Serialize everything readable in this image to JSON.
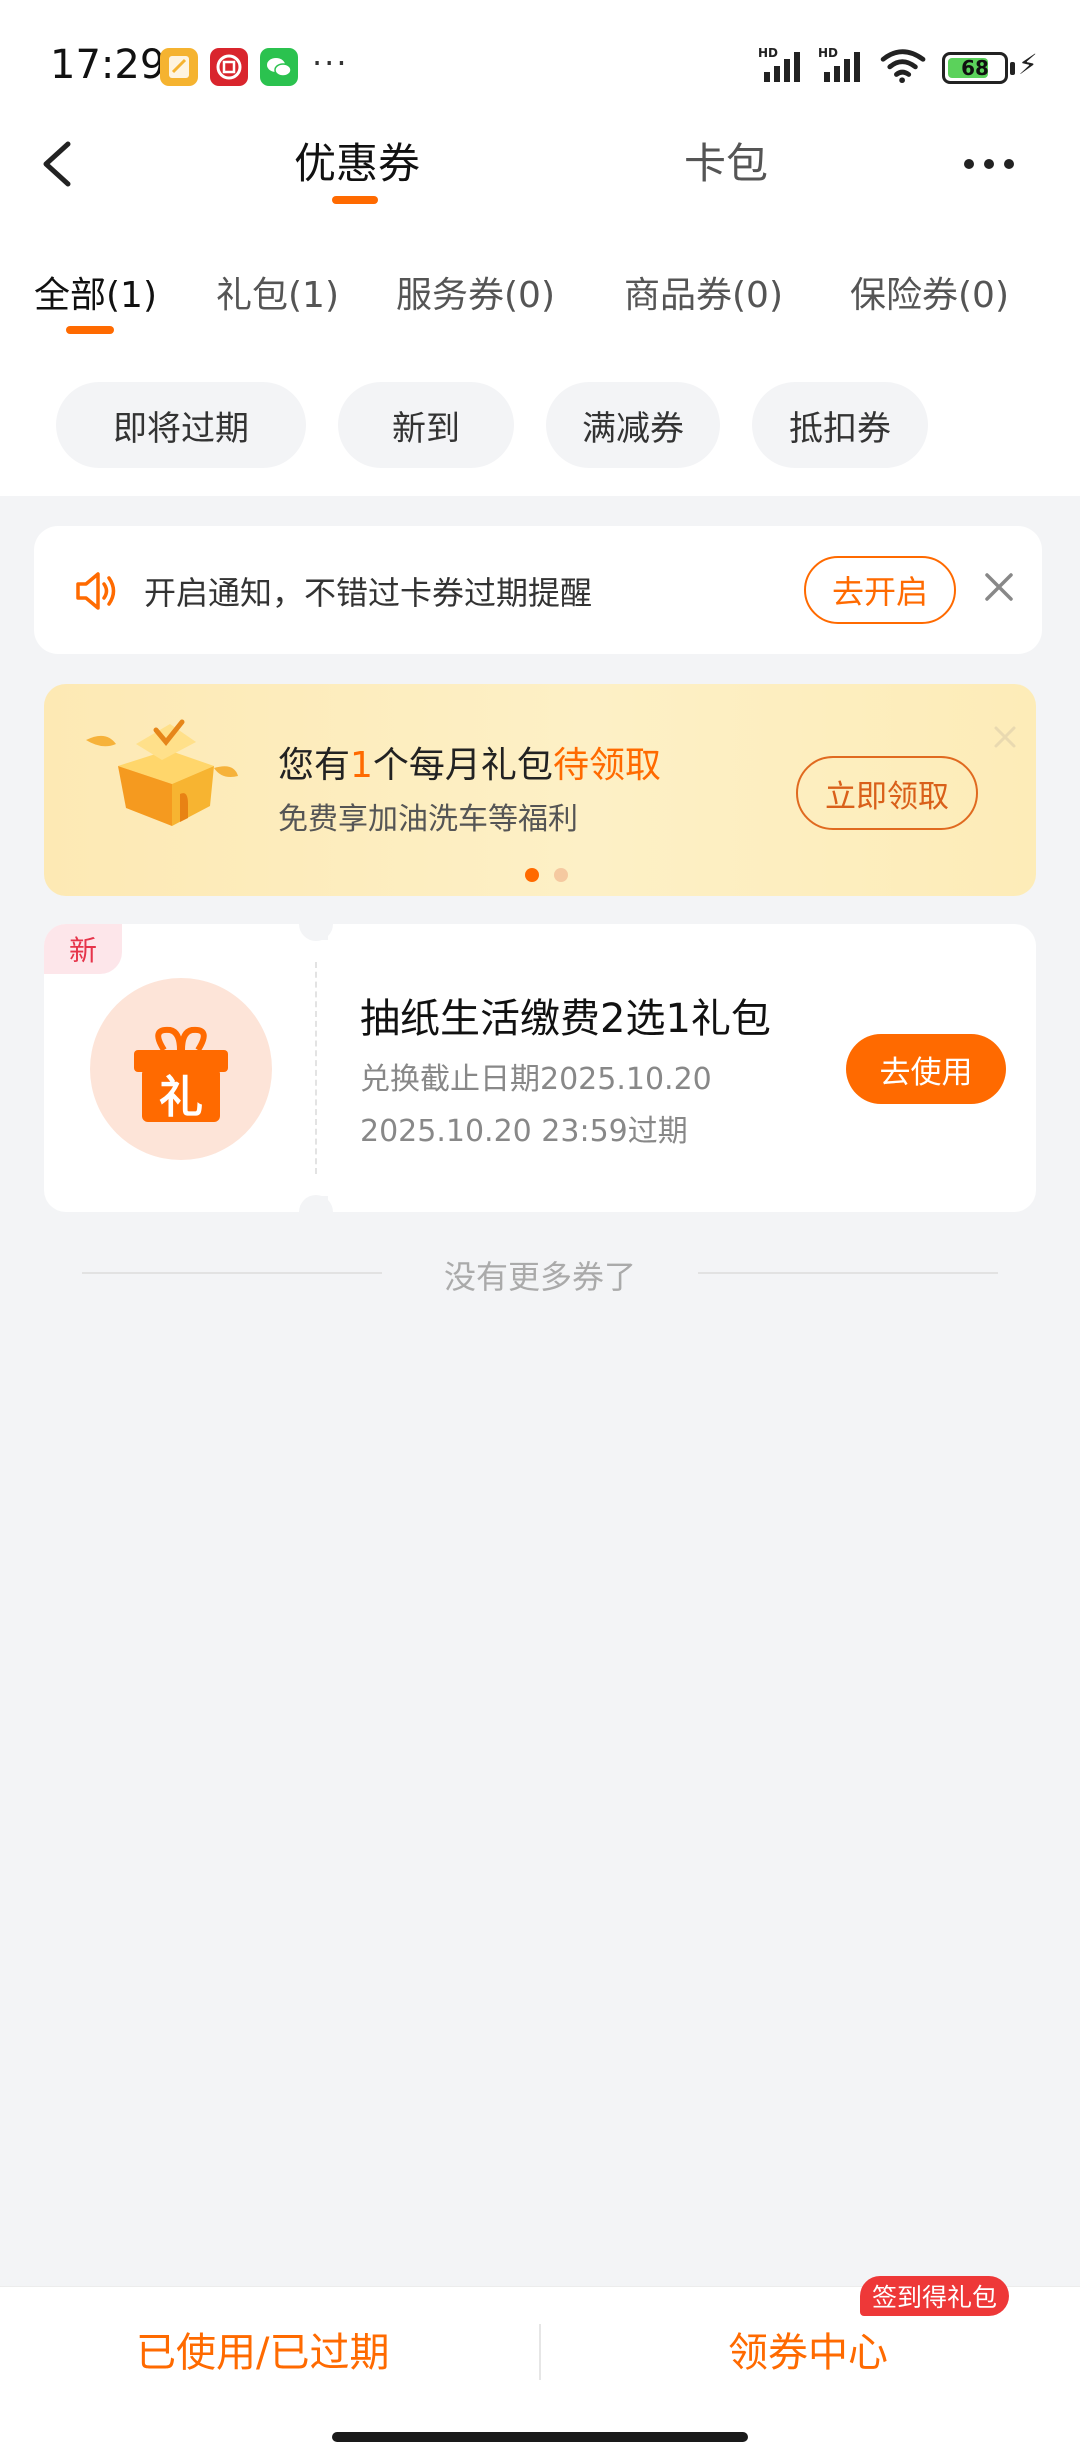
{
  "status_bar": {
    "time": "17:29",
    "more": "···",
    "battery": "68",
    "signal_labels": [
      "HD",
      "HD"
    ]
  },
  "nav": {
    "tabs": [
      {
        "label": "优惠券",
        "active": true
      },
      {
        "label": "卡包",
        "active": false
      }
    ]
  },
  "categories": [
    {
      "label": "全部(1)",
      "active": true
    },
    {
      "label": "礼包(1)"
    },
    {
      "label": "服务券(0)"
    },
    {
      "label": "商品券(0)"
    },
    {
      "label": "保险券(0)"
    }
  ],
  "filters": [
    "即将过期",
    "新到",
    "满减券",
    "抵扣券"
  ],
  "notify": {
    "text": "开启通知，不错过卡券过期提醒",
    "button": "去开启"
  },
  "banner": {
    "title_pre": "您有",
    "title_count": "1",
    "title_mid": "个每月礼包",
    "title_hl": "待领取",
    "subtitle": "免费享加油洗车等福利",
    "button": "立即领取",
    "page_count": 2,
    "active_page": 1
  },
  "coupon": {
    "badge": "新",
    "icon_char": "礼",
    "title": "抽纸生活缴费2选1礼包",
    "redeem_deadline": "兑换截止日期2025.10.20",
    "expires": "2025.10.20 23:59过期",
    "button": "去使用"
  },
  "end_text": "没有更多券了",
  "bottom": {
    "left": "已使用/已过期",
    "right": "领券中心",
    "badge": "签到得礼包"
  },
  "colors": {
    "accent": "#ff6a00",
    "background": "#f3f4f6",
    "badge_red": "#ee3838"
  }
}
